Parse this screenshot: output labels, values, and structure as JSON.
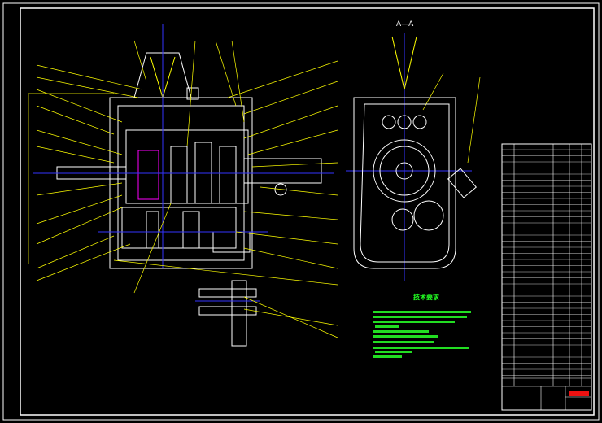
{
  "drawing": {
    "section_label": "A—A",
    "requirements_title": "技术要求",
    "colors": {
      "background": "#000000",
      "frame": "#ffffff",
      "leaders": "#ffff00",
      "centerlines": "#0000ff",
      "text_notes": "#00ff00",
      "title_stamp": "#ff0000",
      "hatch": "#ff00ff"
    }
  }
}
